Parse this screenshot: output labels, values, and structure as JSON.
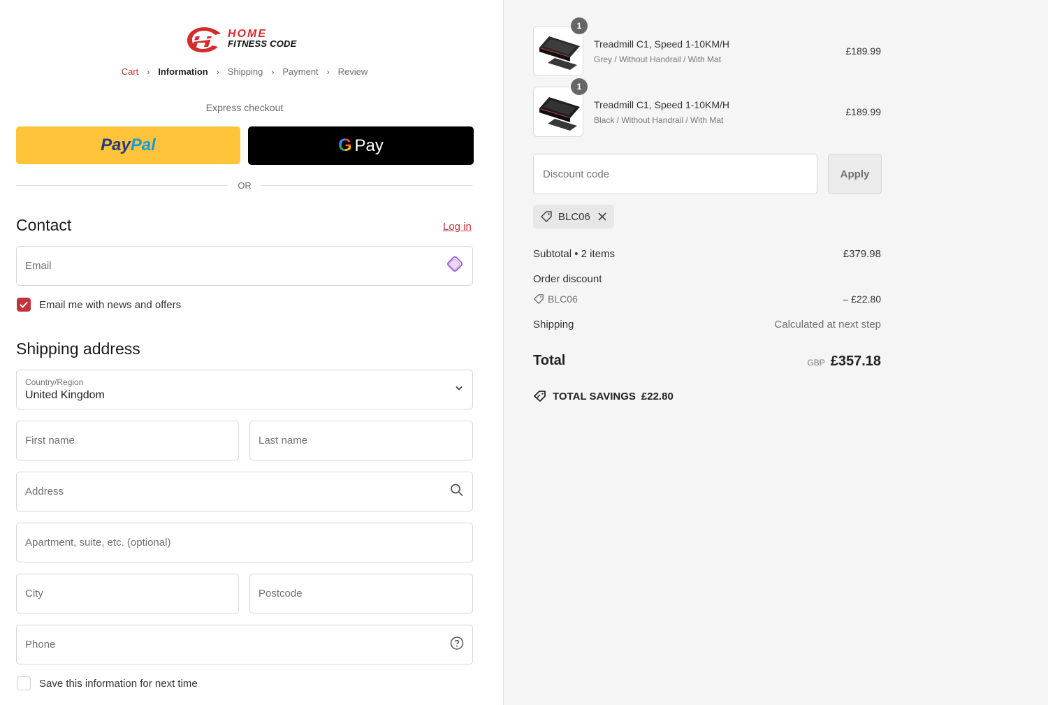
{
  "brand": {
    "line1": "HOME",
    "line2": "FITNESS CODE"
  },
  "breadcrumb": [
    {
      "label": "Cart",
      "state": "link"
    },
    {
      "label": "Information",
      "state": "active"
    },
    {
      "label": "Shipping",
      "state": "inactive"
    },
    {
      "label": "Payment",
      "state": "inactive"
    },
    {
      "label": "Review",
      "state": "inactive"
    }
  ],
  "express": {
    "label": "Express checkout",
    "paypal_pay": "Pay",
    "paypal_pal": "Pal",
    "gpay_g": "G",
    "gpay_label": "Pay",
    "or_label": "OR"
  },
  "contact": {
    "heading": "Contact",
    "login_label": "Log in",
    "email_placeholder": "Email",
    "newsletter_label": "Email me with news and offers",
    "newsletter_checked": true
  },
  "shipping": {
    "heading": "Shipping address",
    "country_label": "Country/Region",
    "country_value": "United Kingdom",
    "first_name_placeholder": "First name",
    "last_name_placeholder": "Last name",
    "address_placeholder": "Address",
    "apartment_placeholder": "Apartment, suite, etc. (optional)",
    "city_placeholder": "City",
    "postcode_placeholder": "Postcode",
    "phone_placeholder": "Phone",
    "save_info_label": "Save this information for next time",
    "save_info_checked": false
  },
  "cart": {
    "items": [
      {
        "qty": "1",
        "name": "Treadmill C1, Speed 1-10KM/H",
        "variant": "Grey / Without Handrail / With Mat",
        "price": "£189.99"
      },
      {
        "qty": "1",
        "name": "Treadmill C1, Speed 1-10KM/H",
        "variant": "Black / Without Handrail / With Mat",
        "price": "£189.99"
      }
    ],
    "discount_placeholder": "Discount code",
    "apply_label": "Apply",
    "applied_code": "BLC06",
    "subtotal_label": "Subtotal • 2 items",
    "subtotal_value": "£379.98",
    "order_discount_label": "Order discount",
    "order_discount_code": "BLC06",
    "order_discount_value": "– £22.80",
    "shipping_label": "Shipping",
    "shipping_value": "Calculated at next step",
    "total_label": "Total",
    "total_currency": "GBP",
    "total_value": "£357.18",
    "savings_label": "TOTAL SAVINGS",
    "savings_value": "£22.80"
  },
  "colors": {
    "accent": "#c2343a",
    "paypal": "#ffc439",
    "sidebar_bg": "#f5f5f5"
  }
}
